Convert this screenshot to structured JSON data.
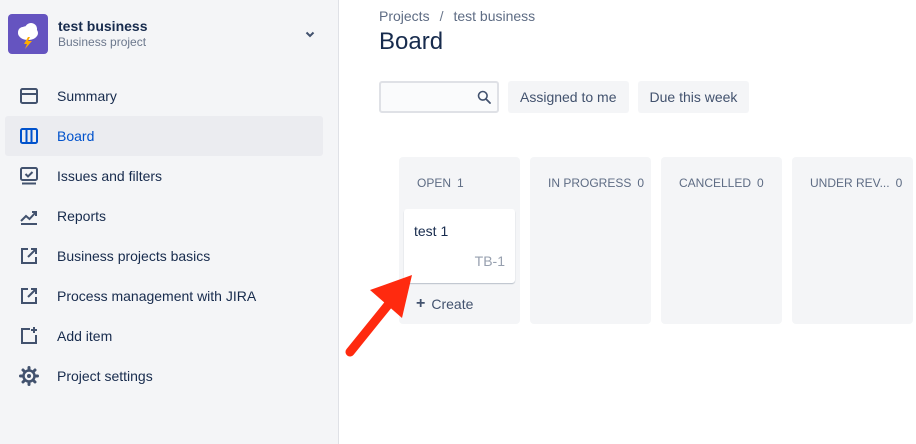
{
  "project": {
    "name": "test business",
    "type": "Business project"
  },
  "sidebar": {
    "items": [
      {
        "label": "Summary",
        "icon": "summary-icon"
      },
      {
        "label": "Board",
        "icon": "board-icon",
        "active": true
      },
      {
        "label": "Issues and filters",
        "icon": "issues-icon"
      },
      {
        "label": "Reports",
        "icon": "reports-icon"
      },
      {
        "label": "Business projects basics",
        "icon": "external-link-icon"
      },
      {
        "label": "Process management with JIRA",
        "icon": "external-link-icon"
      },
      {
        "label": "Add item",
        "icon": "add-item-icon"
      },
      {
        "label": "Project settings",
        "icon": "gear-icon"
      }
    ]
  },
  "breadcrumb": {
    "root": "Projects",
    "separator": "/",
    "current": "test business"
  },
  "page": {
    "title": "Board"
  },
  "toolbar": {
    "search_value": "",
    "filters": [
      "Assigned to me",
      "Due this week"
    ]
  },
  "board": {
    "columns": [
      {
        "name": "OPEN",
        "count": "1"
      },
      {
        "name": "IN PROGRESS",
        "count": "0"
      },
      {
        "name": "CANCELLED",
        "count": "0"
      },
      {
        "name": "UNDER REV...",
        "count": "0"
      }
    ],
    "card": {
      "title": "test 1",
      "key": "TB-1"
    },
    "create_label": "Create"
  },
  "colors": {
    "accent": "#0052CC",
    "avatar": "#6554C0",
    "arrow": "#FF2A0F"
  }
}
